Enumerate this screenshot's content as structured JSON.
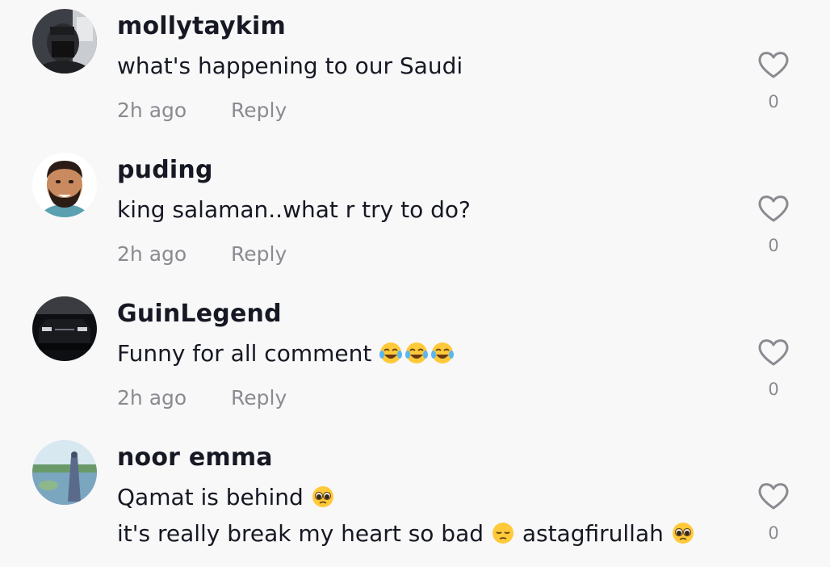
{
  "comments": [
    {
      "username": "mollytaykim",
      "lines": [
        "what's happening to our Saudi"
      ],
      "time": "2h ago",
      "reply_label": "Reply",
      "likes": "0"
    },
    {
      "username": "puding",
      "lines": [
        "king salaman..what r try to do?"
      ],
      "time": "2h ago",
      "reply_label": "Reply",
      "likes": "0"
    },
    {
      "username": "GuinLegend",
      "lines": [
        "Funny for all comment"
      ],
      "emojis": [
        "joy",
        "joy",
        "joy"
      ],
      "time": "2h ago",
      "reply_label": "Reply",
      "likes": "0"
    },
    {
      "username": "noor emma",
      "line1": "Qamat is behind",
      "line2_part1": "it's really break my heart so bad",
      "line2_part2": "astagfirullah",
      "emojis": [
        "pleading-face",
        "pensive-face",
        "pleading-face"
      ],
      "likes": "0"
    }
  ],
  "icons": {
    "like": "heart-outline-icon"
  },
  "colors": {
    "background": "#f8f8f8",
    "text": "#161823",
    "muted": "#8a8b91"
  }
}
